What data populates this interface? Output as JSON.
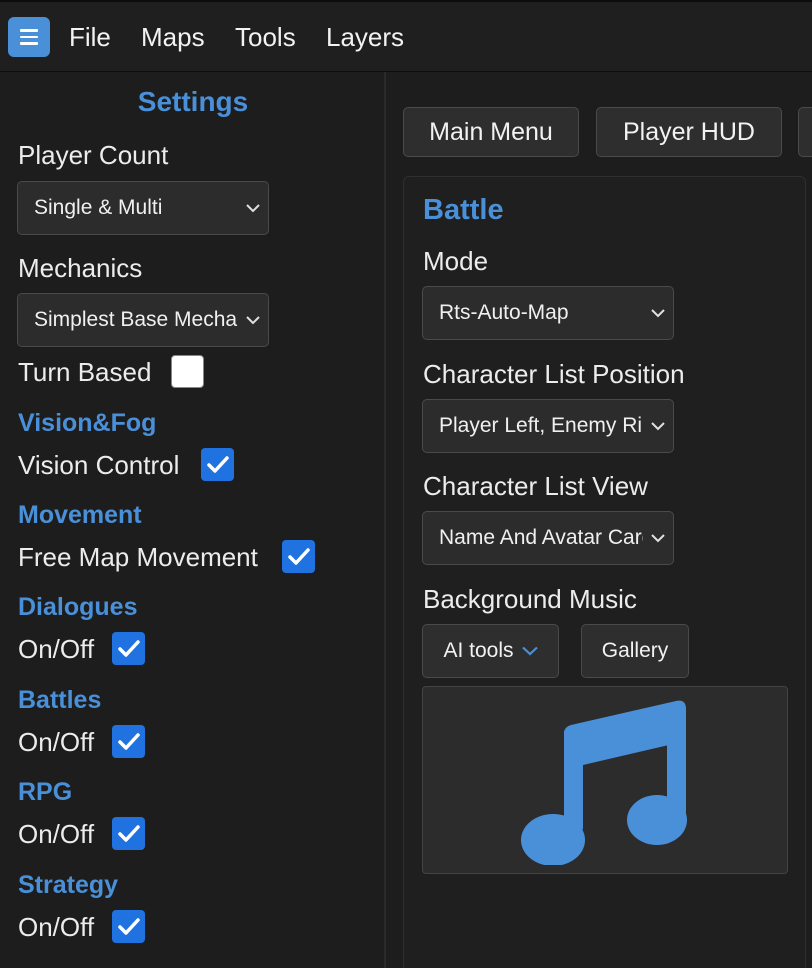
{
  "menubar": {
    "menu_icon": "hamburger-icon",
    "items": [
      "File",
      "Maps",
      "Tools",
      "Layers"
    ]
  },
  "settings": {
    "title": "Settings",
    "player_count": {
      "label": "Player Count",
      "value": "Single & Multi"
    },
    "mechanics": {
      "label": "Mechanics",
      "value": "Simplest Base Mechanics"
    },
    "turn_based": {
      "label": "Turn Based",
      "checked": false
    },
    "vision_fog": {
      "title": "Vision&Fog",
      "toggle_label": "Vision Control",
      "checked": true
    },
    "movement": {
      "title": "Movement",
      "toggle_label": "Free Map Movement",
      "checked": true
    },
    "dialogues": {
      "title": "Dialogues",
      "toggle_label": "On/Off",
      "checked": true
    },
    "battles": {
      "title": "Battles",
      "toggle_label": "On/Off",
      "checked": true
    },
    "rpg": {
      "title": "RPG",
      "toggle_label": "On/Off",
      "checked": true
    },
    "strategy": {
      "title": "Strategy",
      "toggle_label": "On/Off",
      "checked": true
    }
  },
  "tabs": [
    "Main Menu",
    "Player HUD"
  ],
  "battle": {
    "title": "Battle",
    "mode": {
      "label": "Mode",
      "value": "Rts-Auto-Map"
    },
    "list_position": {
      "label": "Character List Position",
      "value": "Player Left, Enemy Right"
    },
    "list_view": {
      "label": "Character List View",
      "value": "Name And Avatar Cards"
    },
    "music": {
      "label": "Background Music",
      "ai_tools_label": "AI tools",
      "gallery_label": "Gallery",
      "icon": "music-note-icon"
    }
  },
  "colors": {
    "accent": "#4a90d9",
    "checkbox": "#1f72e0",
    "background": "#1d1d1d"
  }
}
